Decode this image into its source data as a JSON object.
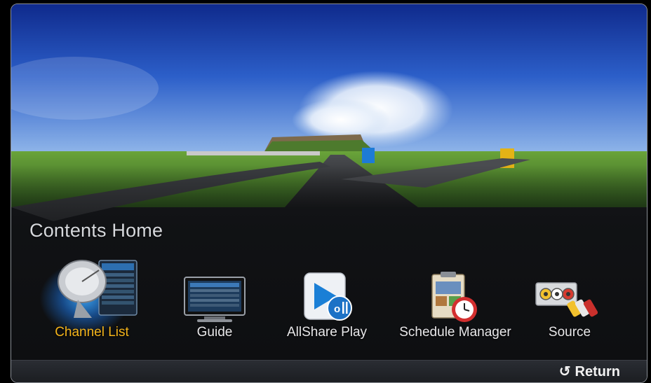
{
  "screen": {
    "title": "Contents Home"
  },
  "items": [
    {
      "label": "Channel List",
      "selected": true,
      "icon": "satellite-dish-icon"
    },
    {
      "label": "Guide",
      "selected": false,
      "icon": "tv-guide-icon"
    },
    {
      "label": "AllShare Play",
      "selected": false,
      "icon": "allshare-play-icon"
    },
    {
      "label": "Schedule Manager",
      "selected": false,
      "icon": "clock-schedule-icon"
    },
    {
      "label": "Source",
      "selected": false,
      "icon": "av-cable-icon"
    }
  ],
  "footer": {
    "return_label": "Return",
    "return_icon": "return-arrow-icon"
  },
  "colors": {
    "selected_label": "#f4b41a",
    "label": "#e8e8ea",
    "title": "#d6d8dc"
  }
}
